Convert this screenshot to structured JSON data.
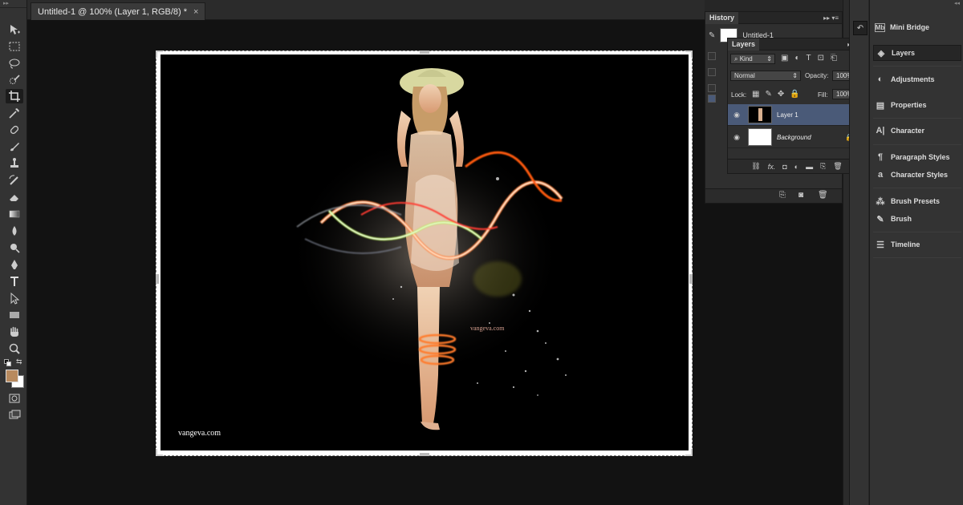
{
  "document": {
    "tab_title": "Untitled-1 @ 100% (Layer 1, RGB/8) *",
    "close_glyph": "×",
    "watermark_bottom": "vangeva.com",
    "watermark_center": "vangeva.com"
  },
  "tools": [
    "move-tool-icon",
    "marquee-tool-icon",
    "lasso-tool-icon",
    "quick-select-tool-icon",
    "crop-tool-icon",
    "eyedropper-tool-icon",
    "spot-healing-tool-icon",
    "brush-tool-icon",
    "clone-stamp-tool-icon",
    "history-brush-tool-icon",
    "eraser-tool-icon",
    "gradient-tool-icon",
    "blur-tool-icon",
    "dodge-tool-icon",
    "pen-tool-icon",
    "type-tool-icon",
    "path-select-tool-icon",
    "rectangle-tool-icon",
    "hand-tool-icon",
    "zoom-tool-icon"
  ],
  "colors": {
    "foreground": "#b88a5e",
    "background": "#ffffff",
    "selection": "#4a5a78",
    "panel": "#2f2f2f"
  },
  "history": {
    "tab": "History",
    "snapshot_label": "Untitled-1"
  },
  "layers": {
    "tab": "Layers",
    "filter_kind": "Kind",
    "blend_mode": "Normal",
    "opacity_label": "Opacity:",
    "opacity_value": "100%",
    "lock_label": "Lock:",
    "fill_label": "Fill:",
    "fill_value": "100%",
    "items": [
      {
        "name": "Layer 1",
        "selected": true
      },
      {
        "name": "Background",
        "selected": false
      }
    ],
    "footer_fx": "fx."
  },
  "dock": {
    "items": [
      {
        "label": "Mini Bridge",
        "icon": "mini-bridge-icon"
      },
      {
        "label": "Layers",
        "icon": "layers-icon"
      },
      {
        "label": "Adjustments",
        "icon": "adjustments-icon"
      },
      {
        "label": "Properties",
        "icon": "properties-icon"
      },
      {
        "label": "Character",
        "icon": "character-icon"
      },
      {
        "label": "Paragraph Styles",
        "icon": "paragraph-styles-icon"
      },
      {
        "label": "Character Styles",
        "icon": "character-styles-icon"
      },
      {
        "label": "Brush Presets",
        "icon": "brush-presets-icon"
      },
      {
        "label": "Brush",
        "icon": "brush-icon"
      },
      {
        "label": "Timeline",
        "icon": "timeline-icon"
      }
    ]
  }
}
